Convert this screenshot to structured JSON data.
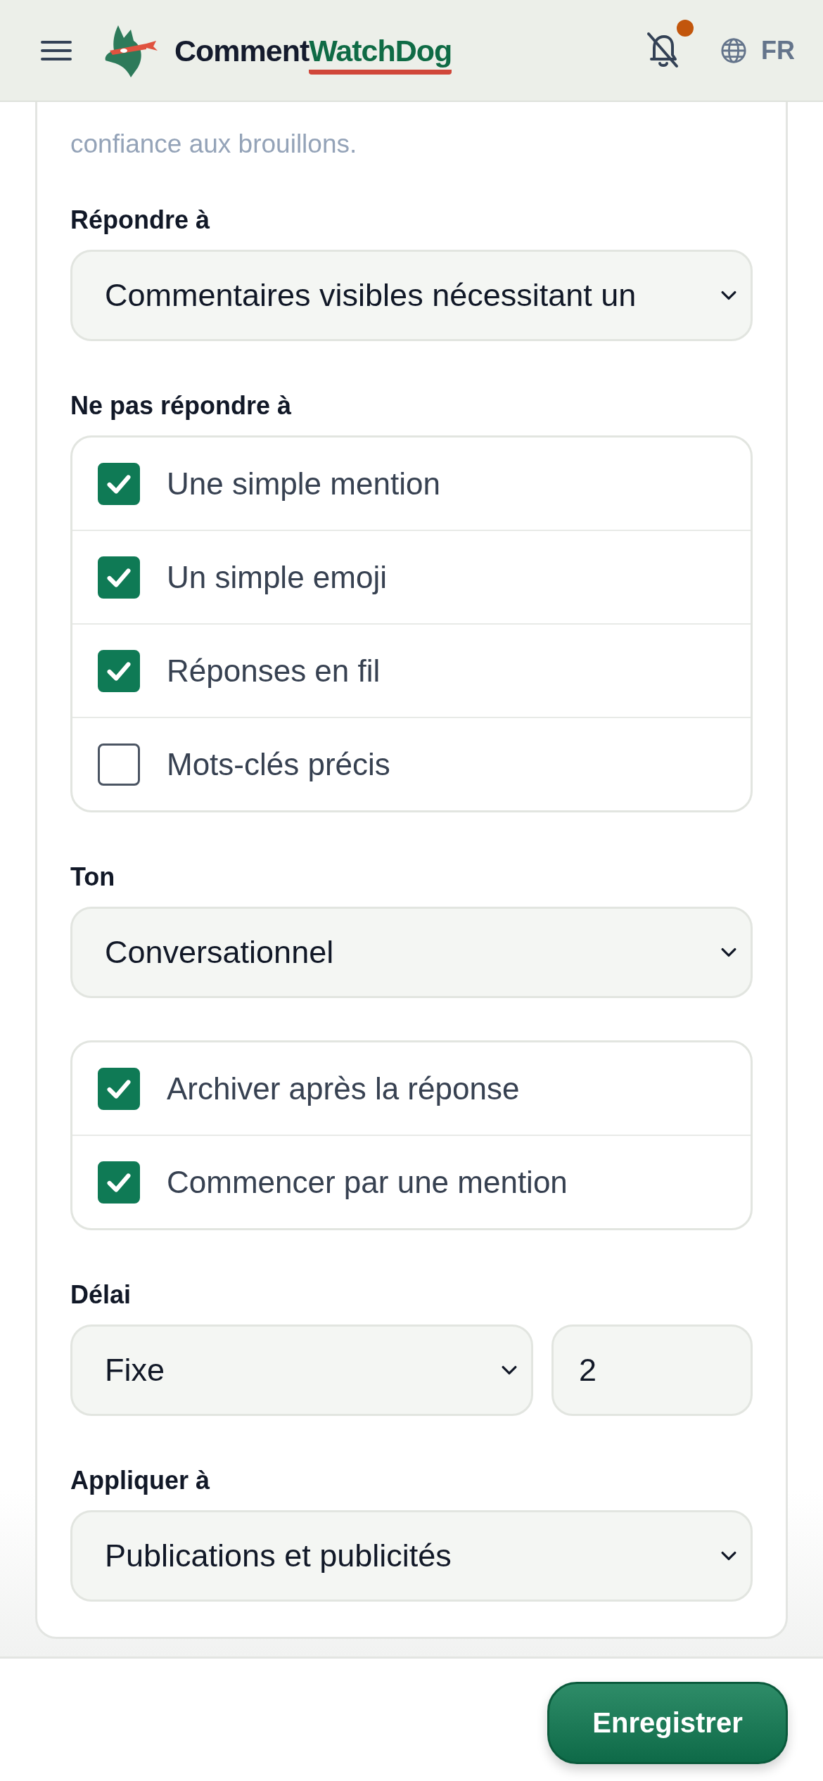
{
  "header": {
    "brand_first": "Comment",
    "brand_second": "WatchDog",
    "unread": true,
    "language": "FR"
  },
  "intro": "confiance aux brouillons.",
  "sections": [
    {
      "kind": "select",
      "label": "Répondre à",
      "value": "Commentaires visibles nécessitant un"
    },
    {
      "kind": "checklist",
      "label": "Ne pas répondre à",
      "items": [
        {
          "label": "Une simple mention",
          "checked": true
        },
        {
          "label": "Un simple emoji",
          "checked": true
        },
        {
          "label": "Réponses en fil",
          "checked": true
        },
        {
          "label": "Mots-clés précis",
          "checked": false
        }
      ]
    },
    {
      "kind": "select",
      "label": "Ton",
      "value": "Conversationnel"
    },
    {
      "kind": "checklist",
      "items": [
        {
          "label": "Archiver après la réponse",
          "checked": true
        },
        {
          "label": "Commencer par une mention",
          "checked": true
        }
      ]
    },
    {
      "kind": "select_number",
      "label": "Délai",
      "value": "Fixe",
      "number": "2"
    },
    {
      "kind": "select",
      "label": "Appliquer à",
      "value": "Publications et publicités"
    }
  ],
  "save_button": "Enregistrer"
}
